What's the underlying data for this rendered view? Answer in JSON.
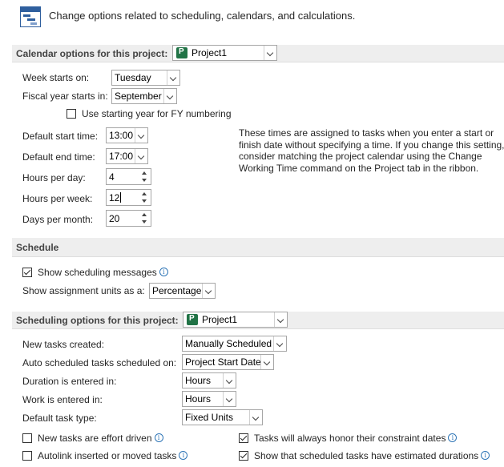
{
  "intro": {
    "text": "Change options related to scheduling, calendars, and calculations."
  },
  "calendar": {
    "section_label": "Calendar options for this project:",
    "project_value": "Project1",
    "week_starts_label": "Week starts on:",
    "week_starts_value": "Tuesday",
    "fiscal_year_label": "Fiscal year starts in:",
    "fiscal_year_value": "September",
    "use_starting_year_label": "Use starting year for FY numbering",
    "use_starting_year_checked": false,
    "default_start_label": "Default start time:",
    "default_start_value": "13:00",
    "default_end_label": "Default end time:",
    "default_end_value": "17:00",
    "hours_per_day_label": "Hours per day:",
    "hours_per_day_value": "4",
    "hours_per_week_label": "Hours per week:",
    "hours_per_week_value": "12",
    "days_per_month_label": "Days per month:",
    "days_per_month_value": "20",
    "note": "These times are assigned to tasks when you enter a start or finish date without specifying a time. If you change this setting, consider matching the project calendar using the Change Working Time command on the Project tab in the ribbon."
  },
  "schedule": {
    "section_label": "Schedule",
    "show_messages_label": "Show scheduling messages",
    "show_messages_checked": true,
    "assignment_units_label": "Show assignment units as a:",
    "assignment_units_value": "Percentage"
  },
  "scheduling": {
    "section_label": "Scheduling options for this project:",
    "project_value": "Project1",
    "new_tasks_label": "New tasks created:",
    "new_tasks_value": "Manually Scheduled",
    "auto_tasks_label": "Auto scheduled tasks scheduled on:",
    "auto_tasks_value": "Project Start Date",
    "duration_label": "Duration is entered in:",
    "duration_value": "Hours",
    "work_label": "Work is entered in:",
    "work_value": "Hours",
    "task_type_label": "Default task type:",
    "task_type_value": "Fixed Units",
    "effort_driven_label": "New tasks are effort driven",
    "effort_driven_checked": false,
    "autolink_label": "Autolink inserted or moved tasks",
    "autolink_checked": false,
    "honor_constraint_label": "Tasks will always honor their constraint dates",
    "honor_constraint_checked": true,
    "estimated_durations_label": "Show that scheduled tasks have estimated durations",
    "estimated_durations_checked": true
  },
  "icons": {
    "intro": "schedule-gantt-icon",
    "project": "project-file-icon",
    "info": "info-icon"
  }
}
